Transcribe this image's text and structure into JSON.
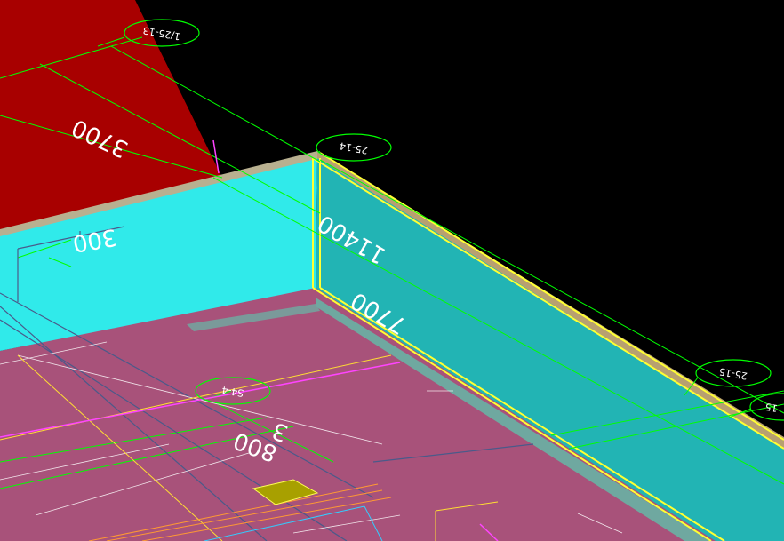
{
  "view": {
    "background": "#000000",
    "colors": {
      "red_plane": "#a80000",
      "cyan_wall": "#30eaea",
      "teal_wall": "#22b4b4",
      "floor": "#a8527a",
      "yellow_edge": "#ffff33",
      "grid_line": "#00ff00",
      "tag_circle": "#00ff00",
      "magenta": "#ff44ff",
      "orange": "#ff9933",
      "beige": "#b8b090",
      "olive": "#a8a000"
    }
  },
  "dimensions": [
    {
      "id": "dim-3700",
      "text": "3700"
    },
    {
      "id": "dim-300",
      "text": "300"
    },
    {
      "id": "dim-11400",
      "text": "11400"
    },
    {
      "id": "dim-7700",
      "text": "7700"
    },
    {
      "id": "dim-800",
      "text": "800"
    },
    {
      "id": "dim-3",
      "text": "3"
    }
  ],
  "grid_tags": [
    {
      "id": "tag-1",
      "text": "1/25-13"
    },
    {
      "id": "tag-2",
      "text": "25-14"
    },
    {
      "id": "tag-3",
      "text": "25-15"
    },
    {
      "id": "tag-4",
      "text": "S4-4"
    },
    {
      "id": "tag-5",
      "text": "15"
    }
  ]
}
